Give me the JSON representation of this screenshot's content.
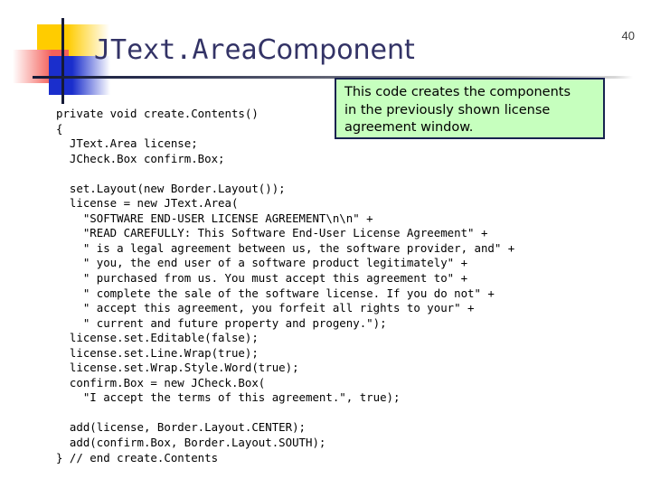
{
  "slide": {
    "page_number": "40",
    "title": {
      "mono_part": "JText.Area",
      "sans_part": "Component"
    },
    "colors": {
      "title": "#333366",
      "callout_background": "#c6ffbe",
      "callout_border": "#17224f",
      "deco_yellow": "#ffcc00",
      "deco_red": "#f4605a",
      "deco_blue": "#1a2ecc",
      "rule": "#151a36",
      "code_text": "#000000"
    }
  },
  "callout": {
    "lines": [
      "This code creates the components",
      "in the previously shown license",
      "agreement window."
    ]
  },
  "code": {
    "lines": [
      "private void create.Contents()",
      "{",
      "  JText.Area license;",
      "  JCheck.Box confirm.Box;",
      "",
      "  set.Layout(new Border.Layout());",
      "  license = new JText.Area(",
      "    \"SOFTWARE END-USER LICENSE AGREEMENT\\n\\n\" +",
      "    \"READ CAREFULLY: This Software End-User License Agreement\" +",
      "    \" is a legal agreement between us, the software provider, and\" +",
      "    \" you, the end user of a software product legitimately\" +",
      "    \" purchased from us. You must accept this agreement to\" +",
      "    \" complete the sale of the software license. If you do not\" +",
      "    \" accept this agreement, you forfeit all rights to your\" +",
      "    \" current and future property and progeny.\");",
      "  license.set.Editable(false);",
      "  license.set.Line.Wrap(true);",
      "  license.set.Wrap.Style.Word(true);",
      "  confirm.Box = new JCheck.Box(",
      "    \"I accept the terms of this agreement.\", true);",
      "",
      "  add(license, Border.Layout.CENTER);",
      "  add(confirm.Box, Border.Layout.SOUTH);",
      "} // end create.Contents"
    ]
  }
}
